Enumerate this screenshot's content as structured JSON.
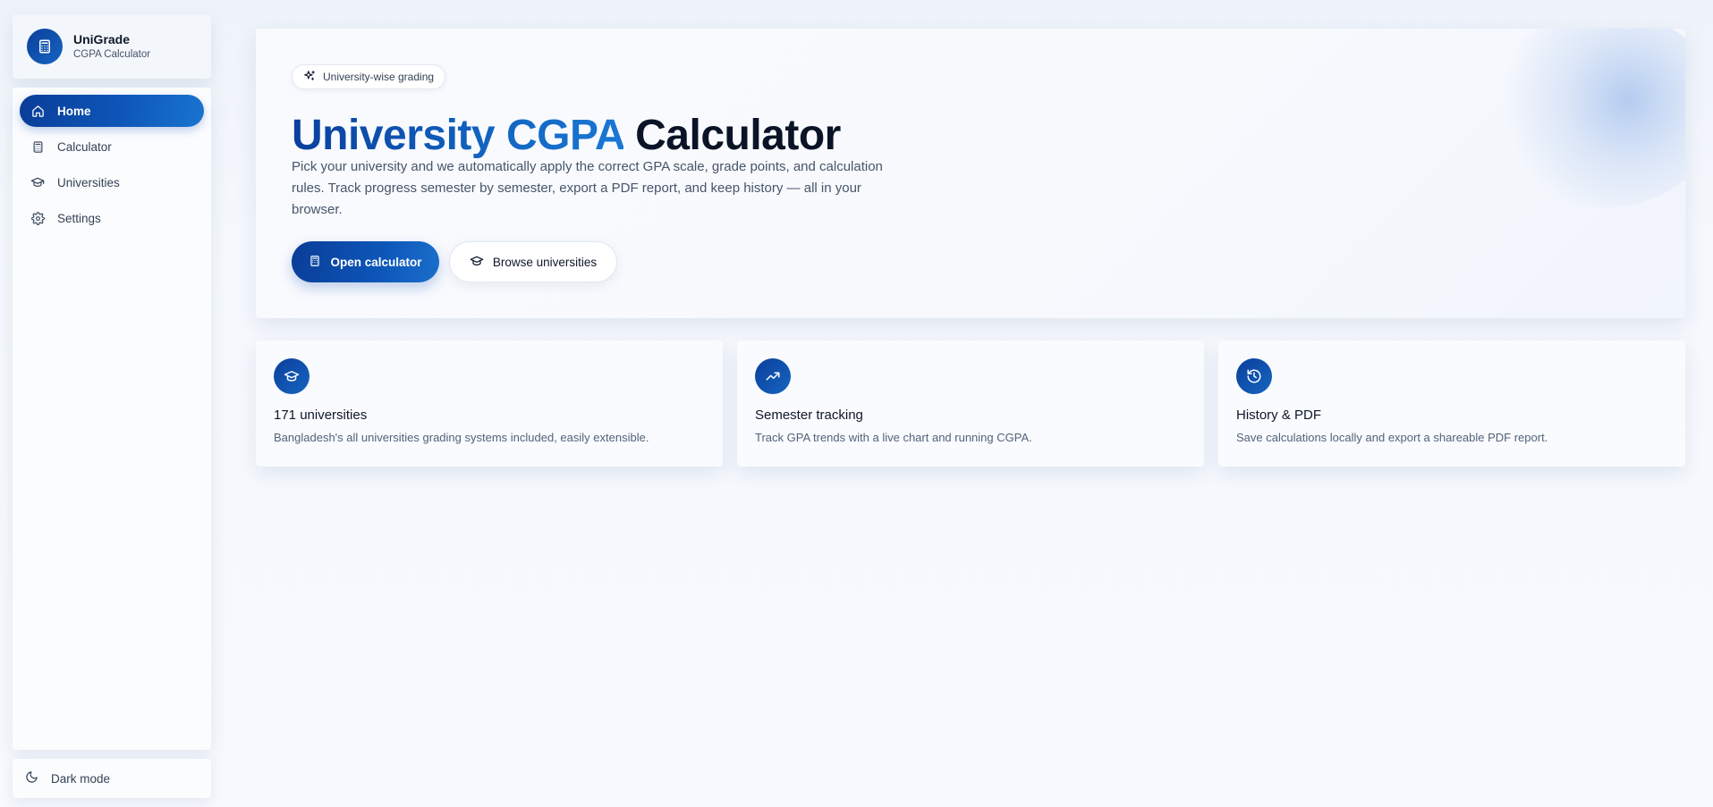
{
  "brand": {
    "name": "UniGrade",
    "subtitle": "CGPA Calculator",
    "logo_icon": "calculator-icon"
  },
  "sidebar": {
    "items": [
      {
        "label": "Home",
        "icon": "home-icon",
        "active": true
      },
      {
        "label": "Calculator",
        "icon": "calculator-icon",
        "active": false
      },
      {
        "label": "Universities",
        "icon": "graduation-cap-icon",
        "active": false
      },
      {
        "label": "Settings",
        "icon": "gear-icon",
        "active": false
      }
    ],
    "dark_mode_label": "Dark mode",
    "dark_mode_icon": "moon-icon"
  },
  "hero": {
    "badge": "University-wise grading",
    "badge_icon": "sparkles-icon",
    "title_highlight": "University CGPA",
    "title_rest": "Calculator",
    "description": "Pick your university and we automatically apply the correct GPA scale, grade points, and calculation rules. Track progress semester by semester, export a PDF report, and keep history — all in your browser.",
    "primary_button": "Open calculator",
    "secondary_button": "Browse universities"
  },
  "features": [
    {
      "title": "171 universities",
      "description": "Bangladesh's all universities grading systems included, easily extensible.",
      "icon": "graduation-cap-icon"
    },
    {
      "title": "Semester tracking",
      "description": "Track GPA trends with a live chart and running CGPA.",
      "icon": "trending-up-icon"
    },
    {
      "title": "History & PDF",
      "description": "Save calculations locally and export a shareable PDF report.",
      "icon": "history-icon"
    }
  ],
  "colors": {
    "accent": "#0d56b8",
    "accent_dark": "#0a3d98",
    "background": "#f7f9fe",
    "text": "#0f172a",
    "muted": "#475569"
  }
}
